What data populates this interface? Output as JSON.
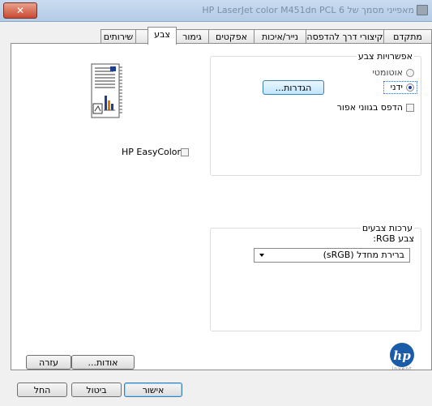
{
  "window": {
    "title": "מאפייני מסמך של HP LaserJet color M451dn PCL 6"
  },
  "tabs": [
    {
      "label": "מתקדם"
    },
    {
      "label": "קיצורי דרך להדפסה"
    },
    {
      "label": "נייר/איכות"
    },
    {
      "label": "אפקטים"
    },
    {
      "label": "גימור"
    },
    {
      "label": "צבע"
    },
    {
      "label": "שירותים"
    }
  ],
  "color_options": {
    "title": "אפשרויות צבע",
    "auto_label": "אוטומטי",
    "manual_label": "ידני",
    "selected": "manual",
    "settings_button": "הגדרות...",
    "grayscale_label": "הדפס בגווני אפור",
    "grayscale_checked": false
  },
  "easycolor": {
    "label": "HP EasyColor",
    "checked": false
  },
  "color_themes": {
    "title": "ערכות צבעים",
    "rgb_label": "צבע RGB:",
    "rgb_value": "ברירת מחדל (sRGB)"
  },
  "hp_logo": {
    "text": "invent"
  },
  "panel_buttons": {
    "about": "אודות...",
    "help": "עזרה"
  },
  "dialog_buttons": {
    "ok": "אישור",
    "cancel": "ביטול",
    "apply": "החל"
  },
  "colors": {
    "accent": "#2c6fd6",
    "hp_blue": "#1b5ca8"
  }
}
